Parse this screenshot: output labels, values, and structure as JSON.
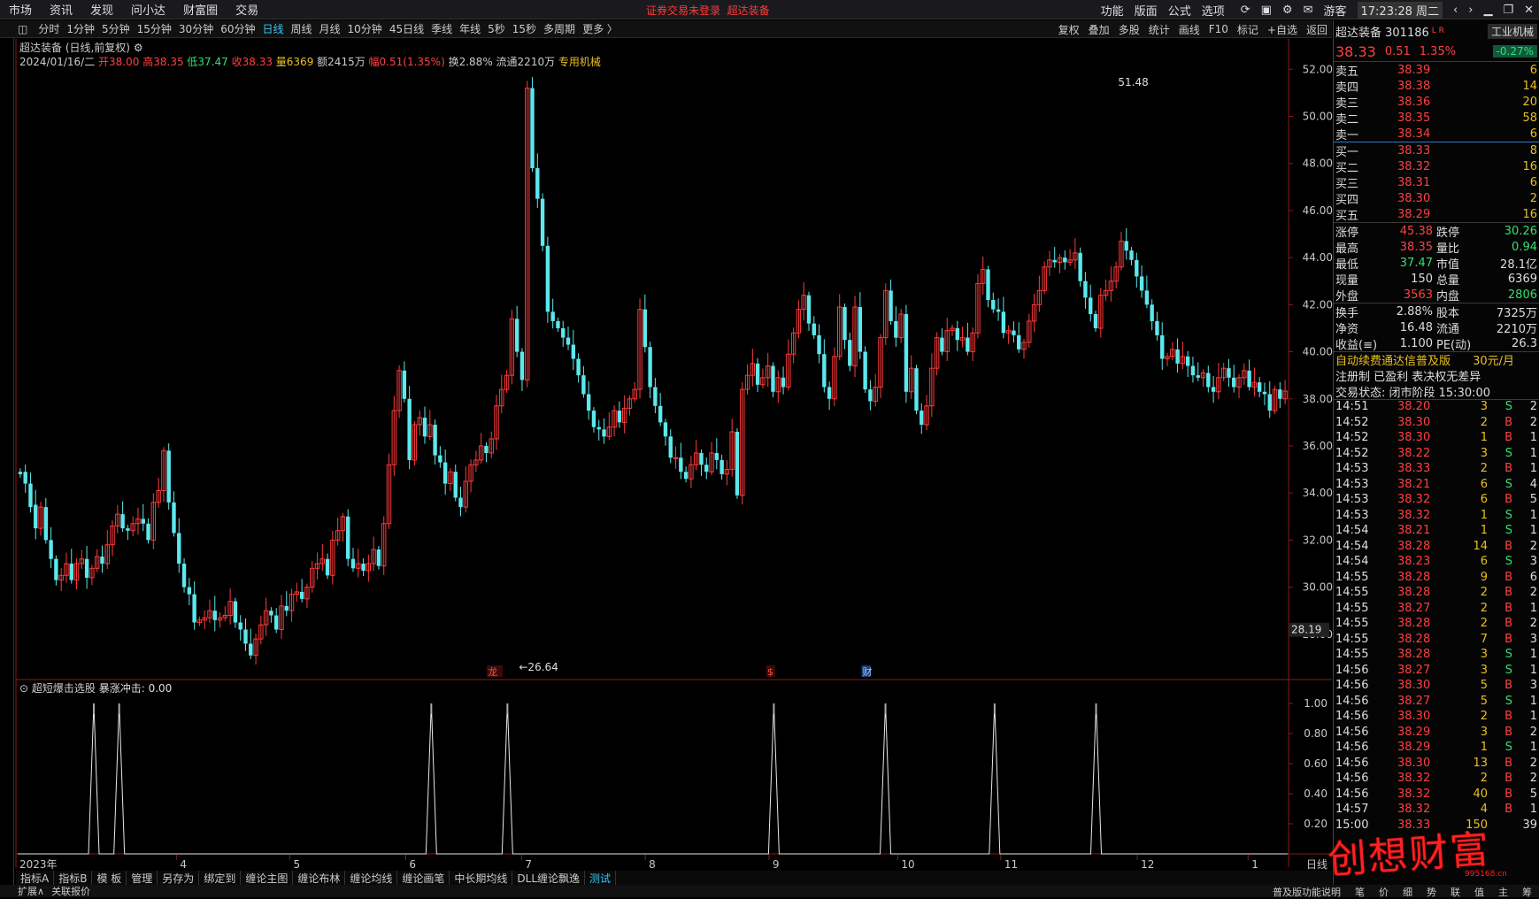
{
  "topbar": {
    "menu": [
      "市场",
      "资讯",
      "发现",
      "问小达",
      "财富圈",
      "交易"
    ],
    "notice": "证券交易未登录",
    "stock_tag": "超达装备",
    "right_menu": [
      "功能",
      "版面",
      "公式",
      "选项"
    ],
    "user": "游客",
    "clock": "17:23:28 周二"
  },
  "periods": [
    "分时",
    "1分钟",
    "5分钟",
    "15分钟",
    "30分钟",
    "60分钟",
    "日线",
    "周线",
    "月线",
    "10分钟",
    "45日线",
    "季线",
    "年线",
    "5秒",
    "15秒",
    "多周期",
    "更多 〉"
  ],
  "active_period": "日线",
  "tools": [
    "复权",
    "叠加",
    "多股",
    "统计",
    "画线",
    "F10",
    "标记",
    "+自选",
    "返回"
  ],
  "chart_header": {
    "title": "超达装备 (日线,前复权)",
    "date": "2024/01/16/二",
    "open": "开38.00",
    "high": "高38.35",
    "low": "低37.47",
    "close": "收38.33",
    "vol": "量6369",
    "amt": "额2415万",
    "amp": "幅0.51(1.35%)",
    "turnover": "换2.88%",
    "float": "流通2210万",
    "industry": "专用机械"
  },
  "colors": {
    "up": "#ff3a3a",
    "down": "#5ce8ec",
    "ma": "#ffffff",
    "accent": "#39c6f5",
    "bg": "#000000"
  },
  "chart_data": [
    {
      "type": "candlestick",
      "title": "超达装备 (日线,前复权)",
      "ylim": [
        26.0,
        52.5
      ],
      "yticks": [
        "52.00",
        "50.00",
        "48.00",
        "46.00",
        "44.00",
        "42.00",
        "40.00",
        "38.00",
        "36.00",
        "34.00",
        "32.00",
        "30.00",
        "28.00"
      ],
      "last_label": "28.19",
      "xticks": [
        "2023年",
        "4",
        "5",
        "6",
        "7",
        "8",
        "9",
        "10",
        "11",
        "12",
        "1"
      ],
      "xtick_pos": [
        0,
        63,
        107,
        152,
        197,
        245,
        293,
        343,
        383,
        436,
        479
      ],
      "annotations": [
        {
          "text": "51.48",
          "index": 213
        },
        {
          "text": "26.64",
          "index": 96
        }
      ],
      "markers": [
        "龙虎榜",
        "$",
        "财"
      ],
      "closes": [
        34.8,
        34.4,
        33.4,
        32.5,
        33.4,
        32.0,
        31.2,
        30.3,
        30.5,
        31.0,
        30.3,
        31.0,
        31.2,
        30.4,
        30.8,
        31.3,
        31.0,
        31.8,
        32.6,
        33.1,
        32.5,
        32.4,
        32.7,
        32.9,
        32.7,
        32.0,
        33.6,
        34.1,
        35.8,
        33.6,
        32.3,
        31.0,
        30.0,
        29.7,
        28.5,
        28.6,
        28.7,
        29.0,
        28.6,
        28.7,
        28.8,
        29.4,
        28.5,
        28.2,
        27.6,
        27.1,
        27.8,
        28.4,
        29.0,
        28.8,
        28.2,
        29.2,
        29.0,
        29.7,
        29.8,
        29.5,
        30.0,
        30.8,
        31.0,
        31.2,
        30.5,
        32.0,
        32.4,
        33.0,
        31.2,
        30.8,
        31.0,
        30.7,
        31.0,
        31.6,
        30.9,
        32.7,
        35.2,
        37.5,
        39.2,
        38.0,
        35.4,
        36.9,
        37.2,
        36.4,
        36.9,
        35.6,
        35.3,
        34.4,
        34.9,
        33.8,
        33.4,
        34.5,
        35.2,
        35.4,
        36.0,
        35.7,
        36.3,
        37.7,
        38.4,
        39.0,
        41.4,
        40.0,
        38.8,
        51.2,
        47.8,
        46.5,
        44.5,
        41.7,
        41.3,
        41.0,
        40.6,
        40.3,
        39.7,
        39.0,
        38.2,
        37.5,
        36.8,
        36.7,
        36.4,
        36.8,
        37.5,
        37.0,
        37.6,
        38.0,
        38.4,
        41.8,
        40.2,
        38.5,
        37.7,
        37.0,
        36.4,
        35.5,
        35.5,
        34.9,
        34.6,
        35.2,
        35.7,
        35.2,
        34.9,
        35.7,
        35.4,
        34.8,
        35.0,
        36.6,
        33.9,
        38.4,
        39.0,
        39.5,
        38.6,
        38.9,
        39.4,
        38.3,
        38.9,
        38.5,
        39.9,
        40.8,
        41.8,
        42.4,
        41.2,
        40.7,
        39.9,
        38.5,
        38.0,
        39.8,
        41.9,
        40.5,
        39.4,
        41.9,
        40.0,
        38.4,
        37.9,
        38.5,
        40.6,
        42.6,
        41.3,
        40.6,
        41.6,
        38.3,
        39.3,
        37.5,
        36.9,
        37.7,
        39.3,
        40.6,
        40.0,
        40.9,
        41.0,
        40.5,
        40.6,
        40.0,
        40.8,
        42.9,
        43.5,
        42.2,
        41.8,
        41.7,
        40.8,
        40.9,
        40.7,
        40.1,
        40.4,
        41.3,
        42.0,
        42.6,
        43.6,
        43.9,
        43.8,
        44.0,
        43.8,
        43.9,
        44.2,
        43.0,
        42.3,
        41.6,
        41.0,
        42.4,
        42.6,
        43.0,
        43.6,
        44.7,
        44.3,
        43.9,
        43.2,
        42.6,
        42.0,
        41.3,
        40.7,
        39.7,
        39.8,
        40.1,
        39.5,
        39.8,
        39.4,
        39.0,
        38.9,
        39.1,
        38.5,
        38.3,
        38.9,
        39.3,
        38.9,
        38.5,
        38.9,
        39.2,
        38.5,
        38.7,
        38.3,
        38.2,
        37.5,
        38.4,
        38.0,
        38.33
      ],
      "opens": [
        34.9,
        34.9,
        34.4,
        33.5,
        32.5,
        33.4,
        32.0,
        31.2,
        30.3,
        30.5,
        31.0,
        30.3,
        31.0,
        31.2,
        30.4,
        30.8,
        31.3,
        31.0,
        31.8,
        32.6,
        33.1,
        32.5,
        32.4,
        32.7,
        32.9,
        32.7,
        32.0,
        33.6,
        34.1,
        35.8,
        33.6,
        32.3,
        31.0,
        30.0,
        29.7,
        28.5,
        28.6,
        28.7,
        29.0,
        28.6,
        28.7,
        28.8,
        29.4,
        28.5,
        28.2,
        27.6,
        27.1,
        27.8,
        28.4,
        29.0,
        28.8,
        28.2,
        29.2,
        29.0,
        29.7,
        29.8,
        29.5,
        30.0,
        30.8,
        31.0,
        31.2,
        30.5,
        32.0,
        32.4,
        33.0,
        31.2,
        30.8,
        31.0,
        30.7,
        31.0,
        31.6,
        30.9,
        32.7,
        35.2,
        37.5,
        39.2,
        38.0,
        35.4,
        36.9,
        37.2,
        36.4,
        36.9,
        35.6,
        35.3,
        34.4,
        34.9,
        33.8,
        33.4,
        34.5,
        35.2,
        35.4,
        36.0,
        35.7,
        36.3,
        37.7,
        38.4,
        39.0,
        41.4,
        40.0,
        38.8,
        51.2,
        47.8,
        46.5,
        44.5,
        41.7,
        41.3,
        41.0,
        40.6,
        40.3,
        39.7,
        39.0,
        38.2,
        37.5,
        36.8,
        36.7,
        36.4,
        36.8,
        37.5,
        37.0,
        37.6,
        38.0,
        38.4,
        41.8,
        40.2,
        38.5,
        37.7,
        37.0,
        36.4,
        35.5,
        35.5,
        34.9,
        34.6,
        35.2,
        35.7,
        35.2,
        34.9,
        35.7,
        35.4,
        34.8,
        35.0,
        36.6,
        33.9,
        38.4,
        39.0,
        39.5,
        38.6,
        38.9,
        39.4,
        38.3,
        38.9,
        38.5,
        39.9,
        40.8,
        41.8,
        42.4,
        41.2,
        40.7,
        39.9,
        38.5,
        38.0,
        39.8,
        41.9,
        40.5,
        39.4,
        41.9,
        40.0,
        38.4,
        37.9,
        38.5,
        40.6,
        42.6,
        41.3,
        40.6,
        41.6,
        38.3,
        39.3,
        37.5,
        36.9,
        37.7,
        39.3,
        40.6,
        40.0,
        40.9,
        41.0,
        40.5,
        40.6,
        40.0,
        40.8,
        42.9,
        43.5,
        42.2,
        41.8,
        41.7,
        40.8,
        40.9,
        40.7,
        40.1,
        40.4,
        41.3,
        42.0,
        42.6,
        43.6,
        43.9,
        43.8,
        44.0,
        43.8,
        43.9,
        44.2,
        43.0,
        42.3,
        41.6,
        41.0,
        42.4,
        42.6,
        43.0,
        43.6,
        44.7,
        44.3,
        43.9,
        43.2,
        42.6,
        42.0,
        41.3,
        40.7,
        39.7,
        39.8,
        40.1,
        39.5,
        39.8,
        39.4,
        39.0,
        38.9,
        39.1,
        38.5,
        38.3,
        38.9,
        39.3,
        38.9,
        38.5,
        38.9,
        39.2,
        38.5,
        38.7,
        38.3,
        38.2,
        37.5,
        38.4,
        38.0
      ]
    },
    {
      "type": "line",
      "title": "超短爆击选股",
      "series_label": "暴涨冲击: 0.00",
      "ylim": [
        0,
        1.1
      ],
      "yticks": [
        "1.00",
        "0.80",
        "0.60",
        "0.40",
        "0.20"
      ],
      "spike_indices": [
        30,
        40,
        163,
        193,
        298,
        342,
        385,
        425
      ]
    }
  ],
  "bottom_tabs": [
    "指标A",
    "指标B",
    "模 板",
    "管理",
    "另存为",
    "绑定到",
    "缠论主图",
    "缠论布林",
    "缠论均线",
    "缠论画笔",
    "中长期均线",
    "DLL缠论飘逸",
    "测试"
  ],
  "active_tab": "测试",
  "right_label": "日线",
  "footer": {
    "left": [
      "扩展∧",
      "关联报价"
    ],
    "right": [
      "笔",
      "价",
      "细",
      "势",
      "联",
      "值",
      "主",
      "筹"
    ],
    "right_note": "普及版功能说明"
  },
  "panel": {
    "name": "超达装备 301186",
    "marks": "L R",
    "industry": "工业机械",
    "price": "38.33",
    "change": "0.51",
    "pct": "1.35%",
    "idx_pct": "-0.27%",
    "asks": [
      [
        "卖五",
        "38.39",
        "6"
      ],
      [
        "卖四",
        "38.38",
        "14"
      ],
      [
        "卖三",
        "38.36",
        "20"
      ],
      [
        "卖二",
        "38.35",
        "58"
      ],
      [
        "卖一",
        "38.34",
        "6"
      ]
    ],
    "bids": [
      [
        "买一",
        "38.33",
        "8"
      ],
      [
        "买二",
        "38.32",
        "16"
      ],
      [
        "买三",
        "38.31",
        "6"
      ],
      [
        "买四",
        "38.30",
        "2"
      ],
      [
        "买五",
        "38.29",
        "16"
      ]
    ],
    "stats1": [
      [
        "涨停",
        "45.38",
        "跌停",
        "30.26"
      ],
      [
        "最高",
        "38.35",
        "量比",
        "0.94"
      ],
      [
        "最低",
        "37.47",
        "市值",
        "28.1亿"
      ],
      [
        "现量",
        "150",
        "总量",
        "6369"
      ],
      [
        "外盘",
        "3563",
        "内盘",
        "2806"
      ]
    ],
    "stats2": [
      [
        "换手",
        "2.88%",
        "股本",
        "7325万"
      ],
      [
        "净资",
        "16.48",
        "流通",
        "2210万"
      ],
      [
        "收益(≡)",
        "1.100",
        "PE(动)",
        "26.3"
      ]
    ],
    "promo": "自动续费通达信普及版",
    "promo_price": "30元/月",
    "reg": "注册制 已盈利 表决权无差异",
    "status": "交易状态: 闭市阶段 15:30:00",
    "ticks": [
      [
        "14:51",
        "38.20",
        "3",
        "S",
        "2"
      ],
      [
        "14:52",
        "38.30",
        "2",
        "B",
        "2"
      ],
      [
        "14:52",
        "38.30",
        "1",
        "B",
        "1"
      ],
      [
        "14:52",
        "38.22",
        "3",
        "S",
        "1"
      ],
      [
        "14:53",
        "38.33",
        "2",
        "B",
        "1"
      ],
      [
        "14:53",
        "38.21",
        "6",
        "S",
        "4"
      ],
      [
        "14:53",
        "38.32",
        "6",
        "B",
        "5"
      ],
      [
        "14:53",
        "38.32",
        "1",
        "S",
        "1"
      ],
      [
        "14:54",
        "38.21",
        "1",
        "S",
        "1"
      ],
      [
        "14:54",
        "38.28",
        "14",
        "B",
        "2"
      ],
      [
        "14:54",
        "38.23",
        "6",
        "S",
        "3"
      ],
      [
        "14:55",
        "38.28",
        "9",
        "B",
        "6"
      ],
      [
        "14:55",
        "38.28",
        "2",
        "B",
        "2"
      ],
      [
        "14:55",
        "38.27",
        "2",
        "B",
        "1"
      ],
      [
        "14:55",
        "38.28",
        "2",
        "B",
        "2"
      ],
      [
        "14:55",
        "38.28",
        "7",
        "B",
        "3"
      ],
      [
        "14:55",
        "38.28",
        "3",
        "S",
        "1"
      ],
      [
        "14:56",
        "38.27",
        "3",
        "S",
        "1"
      ],
      [
        "14:56",
        "38.30",
        "5",
        "B",
        "3"
      ],
      [
        "14:56",
        "38.27",
        "5",
        "S",
        "1"
      ],
      [
        "14:56",
        "38.30",
        "2",
        "B",
        "1"
      ],
      [
        "14:56",
        "38.29",
        "3",
        "B",
        "2"
      ],
      [
        "14:56",
        "38.29",
        "1",
        "S",
        "1"
      ],
      [
        "14:56",
        "38.30",
        "13",
        "B",
        "2"
      ],
      [
        "14:56",
        "38.32",
        "2",
        "B",
        "2"
      ],
      [
        "14:56",
        "38.32",
        "40",
        "B",
        "5"
      ],
      [
        "14:57",
        "38.32",
        "4",
        "B",
        "1"
      ],
      [
        "15:00",
        "38.33",
        "150",
        "",
        "39"
      ]
    ]
  },
  "watermark": "创想财富",
  "watermark_url": "995168.cn"
}
